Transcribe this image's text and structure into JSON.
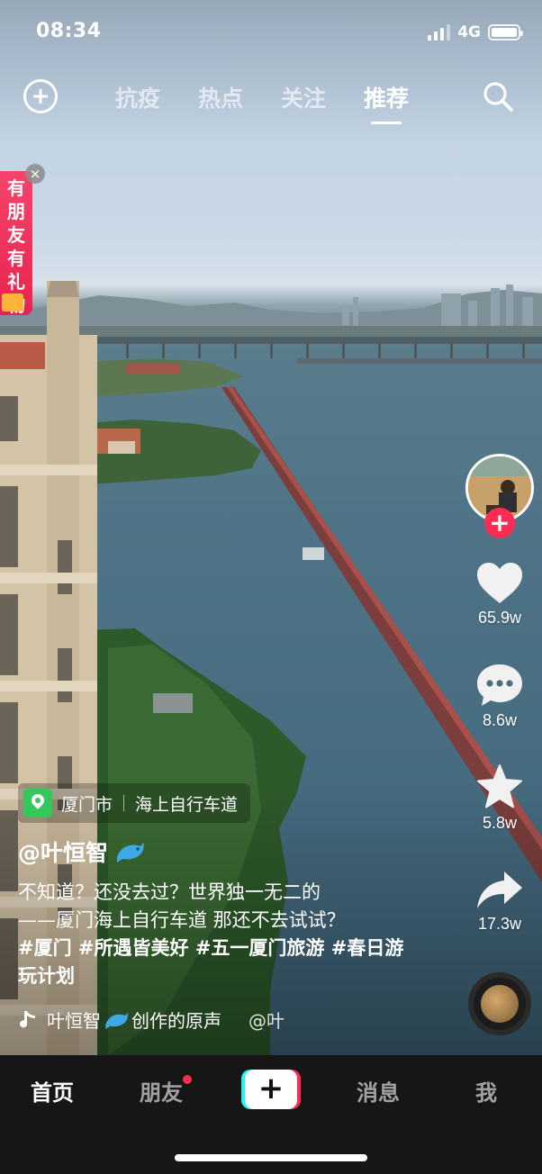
{
  "status_bar": {
    "time": "08:34",
    "network": "4G"
  },
  "top_nav": {
    "tabs": [
      {
        "label": "抗疫",
        "active": false
      },
      {
        "label": "热点",
        "active": false
      },
      {
        "label": "关注",
        "active": false
      },
      {
        "label": "推荐",
        "active": true
      }
    ],
    "add_icon": "plus-circle-icon",
    "search_icon": "search-icon"
  },
  "gift_banner": {
    "text": "有朋友有礼物",
    "close_icon": "close-icon",
    "close_glyph": "×"
  },
  "actions": {
    "follow_glyph": "+",
    "likes": "65.9w",
    "comments": "8.6w",
    "favorites": "5.8w",
    "shares": "17.3w"
  },
  "caption": {
    "location_city": "厦门市",
    "location_place": "海上自行车道",
    "username": "@叶恒智",
    "description_line1": "不知道？还没去过？世界独一无二的",
    "description_line2": "——厦门海上自行车道 那还不去试试？",
    "hashtags": "#厦门 #所遇皆美好 #五一厦门旅游 #春日游玩计划",
    "music_text": "叶恒智",
    "music_suffix": "创作的原声",
    "music_tail": "@叶"
  },
  "bottom_nav": {
    "items": [
      {
        "label": "首页",
        "active": true
      },
      {
        "label": "朋友",
        "active": false,
        "dot": true
      },
      {
        "label": "消息",
        "active": false
      },
      {
        "label": "我",
        "active": false
      }
    ],
    "create_glyph": "+"
  },
  "colors": {
    "accent": "#fe2c55",
    "cyan": "#25f4ee",
    "location_green": "#34c759",
    "bar_bg": "#161616"
  }
}
